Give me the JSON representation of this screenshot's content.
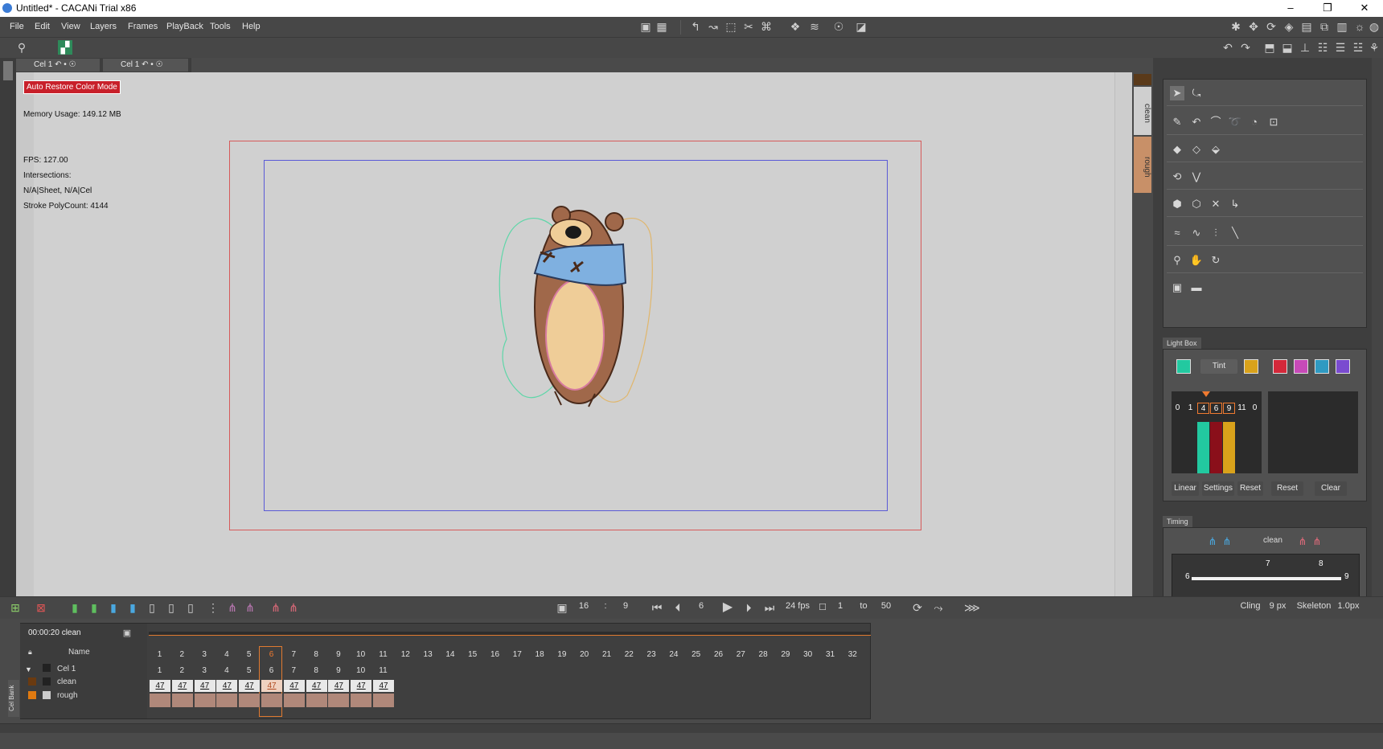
{
  "window": {
    "title": "Untitled* - CACANi Trial  x86",
    "controls": [
      "–",
      "❐",
      "✕"
    ]
  },
  "menu": [
    "File",
    "Edit",
    "View",
    "Layers",
    "Frames",
    "PlayBack",
    "Tools",
    "Help"
  ],
  "cel_tabs": [
    {
      "label": "Cel 1"
    },
    {
      "label": "Cel 1"
    }
  ],
  "canvas": {
    "badge": "Auto Restore Color Mode",
    "memory": "Memory Usage: 149.12 MB",
    "fps": "FPS: 127.00",
    "intersections": "Intersections:",
    "sheet": "N/A|Sheet, N/A|Cel",
    "polycount": "Stroke PolyCount: 4144"
  },
  "layer_tabs": [
    "clean",
    "rough"
  ],
  "lightbox": {
    "title": "Light Box",
    "tint_label": "Tint",
    "numbers": [
      "0",
      "1",
      "4",
      "6",
      "9",
      "11",
      "0"
    ],
    "buttons": [
      "Linear",
      "Settings",
      "Reset",
      "Reset",
      "Clear"
    ],
    "colors": {
      "green": "#22c9a0",
      "gold": "#d9a21b",
      "red": "#d4283a",
      "magenta": "#c74ab8",
      "teal": "#2f9ac2",
      "purple": "#7a4bd0"
    }
  },
  "timing": {
    "title": "Timing",
    "layer": "clean",
    "marker_a": "7",
    "marker_b": "8",
    "start": "6",
    "end": "9"
  },
  "playback": {
    "frame_a": "16",
    "sep": ":",
    "frame_b": "9",
    "current": "6",
    "fps": "24 fps",
    "range_from": "1",
    "to_label": "to",
    "range_to": "50",
    "cling_label": "Cling",
    "cling_value": "9 px",
    "skeleton_label": "Skeleton",
    "skeleton_value": "1.0px"
  },
  "timeline": {
    "time": "00:00:20  clean",
    "name_header": "Name",
    "frames": [
      "1",
      "2",
      "3",
      "4",
      "5",
      "6",
      "7",
      "8",
      "9",
      "10",
      "11",
      "12",
      "13",
      "14",
      "15",
      "16",
      "17",
      "18",
      "19",
      "20",
      "21",
      "22",
      "23",
      "24",
      "25",
      "26",
      "27",
      "28",
      "29",
      "30",
      "31",
      "32"
    ],
    "cel_row": {
      "label": "Cel 1",
      "cells": [
        "1",
        "2",
        "3",
        "4",
        "5",
        "6",
        "7",
        "8",
        "9",
        "10",
        "11"
      ]
    },
    "clean_row": {
      "label": "clean",
      "cells": [
        "47",
        "47",
        "47",
        "47",
        "47",
        "47",
        "47",
        "47",
        "47",
        "47",
        "47"
      ]
    },
    "rough_row": {
      "label": "rough"
    },
    "cel_bank": "Cel Bank"
  }
}
